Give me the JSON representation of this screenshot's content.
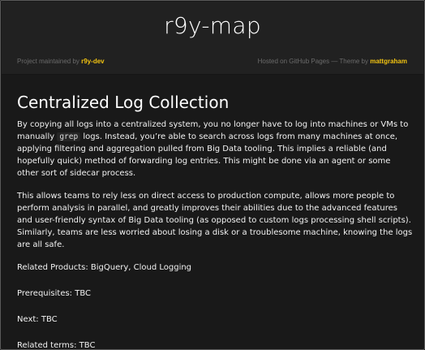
{
  "header": {
    "title": "r9y-map",
    "maintained_prefix": "Project maintained by ",
    "maintainer": "r9y-dev",
    "hosted_text": "Hosted on GitHub Pages — Theme by ",
    "theme_author": "mattgraham"
  },
  "article": {
    "title": "Centralized Log Collection",
    "p1_before": "By copying all logs into a centralized system, you no longer have to log into machines or VMs to manually ",
    "p1_code": "grep",
    "p1_after": " logs. Instead, you’re able to search across logs from many machines at once, applying filtering and aggregation pulled from Big Data tooling. This implies a reliable (and hopefully quick) method of forwarding log entries. This might be done via an agent or some other sort of sidecar process.",
    "p2": "This allows teams to rely less on direct access to production compute, allows more people to perform analysis in parallel, and greatly improves their abilities due to the advanced features and user-friendly syntax of Big Data tooling (as opposed to custom logs processing shell scripts). Similarly, teams are less worried about losing a disk or a troublesome machine, knowing the logs are all safe.",
    "related_products": "Related Products: BigQuery, Cloud Logging",
    "prerequisites": "Prerequisites: TBC",
    "next": "Next: TBC",
    "related_terms": "Related terms: TBC"
  },
  "colors": {
    "background": "#191919",
    "header_background": "#212121",
    "accent_link": "#f2c311",
    "muted_text": "#6b6b6b",
    "text": "#ffffff"
  }
}
